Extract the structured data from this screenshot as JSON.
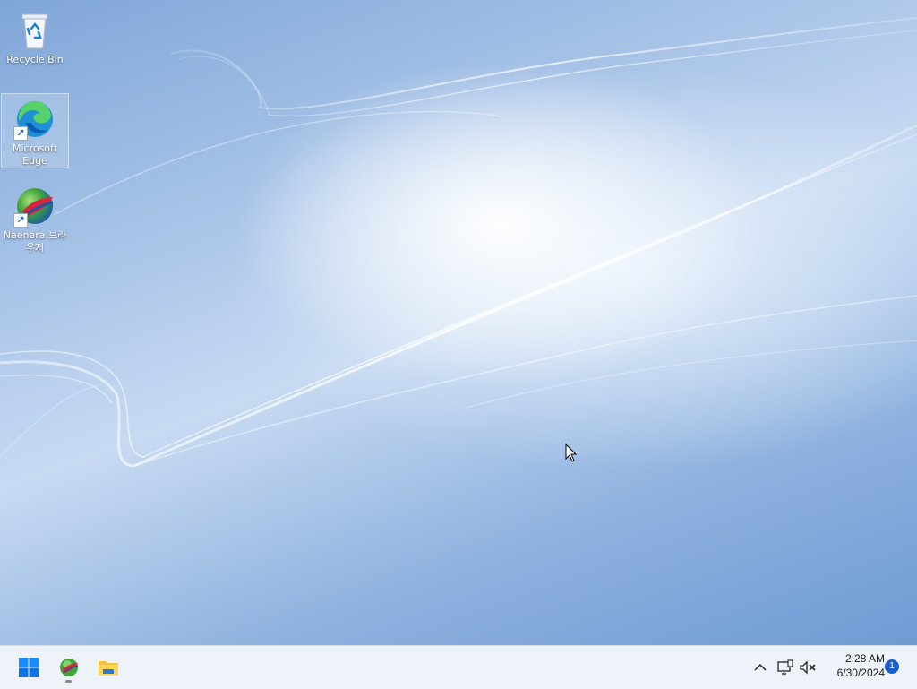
{
  "desktop": {
    "icons": [
      {
        "label": "Recycle Bin",
        "icon": "recycle-bin-icon"
      },
      {
        "label": "Microsoft Edge",
        "icon": "edge-icon",
        "shortcut": true
      },
      {
        "label": "Naenara 브라우저",
        "icon": "naenara-icon",
        "shortcut": true
      }
    ]
  },
  "taskbar": {
    "start": {
      "icon": "windows-start-icon"
    },
    "apps": [
      {
        "name": "Naenara Browser",
        "icon": "naenara-icon",
        "running": true
      },
      {
        "name": "File Explorer",
        "icon": "folder-icon",
        "running": false
      }
    ],
    "tray": {
      "icons": [
        "chevron-up-icon",
        "network-icon",
        "volume-muted-icon"
      ],
      "time": "2:28 AM",
      "date": "6/30/2024",
      "notification_count": "1"
    }
  },
  "colors": {
    "accent": "#1d5fc8",
    "taskbar_bg": "#eef3f9",
    "wallpaper_base": "#8fb2df"
  }
}
